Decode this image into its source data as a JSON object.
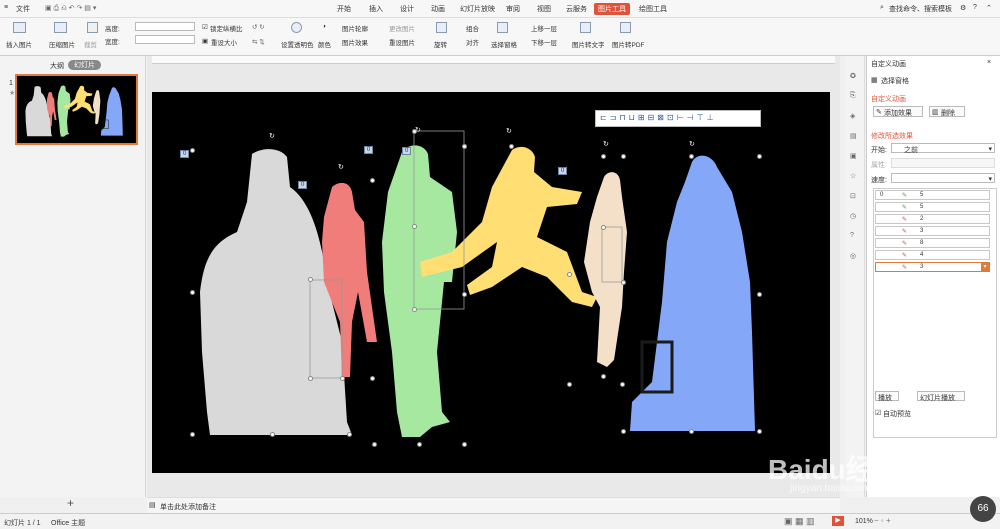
{
  "menu": {
    "file": "文件",
    "tabs": [
      "开始",
      "插入",
      "设计",
      "动画",
      "幻灯片放映",
      "审阅",
      "视图",
      "云服务",
      "图片工具",
      "绘图工具"
    ],
    "active_tab": "图片工具",
    "search": "查找命令、搜索模板"
  },
  "ribbon": {
    "insert_picture": "插入图片",
    "compress_picture": "压缩图片",
    "crop": "裁剪",
    "height_label": "高度:",
    "width_label": "宽度:",
    "lock_ratio": "锁定纵横比",
    "reset_size": "重设大小",
    "set_transparent": "设置透明色",
    "color": "颜色",
    "picture_outline": "图片轮廓",
    "picture_effect": "图片效果",
    "change_picture": "更改图片",
    "reset_picture": "重设图片",
    "rotate": "旋转",
    "group": "组合",
    "align": "对齐",
    "select_pane": "选择窗格",
    "bring_forward": "上移一层",
    "send_backward": "下移一层",
    "pic_to_text": "图片转文字",
    "pic_to_pdf": "图片转PDF"
  },
  "leftpane": {
    "tab_outline": "大纲",
    "tab_slides": "幻灯片",
    "slide_number": "1",
    "add_slide": "+"
  },
  "notes": {
    "placeholder": "单击此处添加备注"
  },
  "rightpane": {
    "title": "自定义动画",
    "select_pane": "选择窗格",
    "section_custom": "自定义动画",
    "add_effect": "添加效果",
    "delete": "删除",
    "section_modify": "修改所选效果",
    "start_label": "开始:",
    "start_value": "之前",
    "property_label": "属性:",
    "speed_label": "速度:",
    "anim_list": [
      {
        "num": "0",
        "label": "5"
      },
      {
        "num": "",
        "label": "5"
      },
      {
        "num": "",
        "label": "2"
      },
      {
        "num": "",
        "label": "3"
      },
      {
        "num": "",
        "label": "8"
      },
      {
        "num": "",
        "label": "4"
      },
      {
        "num": "",
        "label": "3"
      }
    ],
    "play": "播放",
    "slideshow": "幻灯片播放",
    "autopreview": "自动预览"
  },
  "slide": {
    "tags": [
      "0",
      "0",
      "0",
      "0",
      "0"
    ]
  },
  "status": {
    "slide_info": "幻灯片 1 / 1",
    "theme": "Office 主题",
    "zoom": "101%",
    "cpu_badge": "66",
    "watermark": "Baidu经验",
    "watermark_sub": "jingyan.baidu.com"
  },
  "colors": {
    "active_tab": "#e0533b",
    "section_title": "#e0533b",
    "fig_gray": "#d9d9d9",
    "fig_red": "#f07d7a",
    "fig_green": "#a6e8a0",
    "fig_yellow": "#ffdf73",
    "fig_beige": "#f4e0c8",
    "fig_blue": "#84a8f7"
  }
}
